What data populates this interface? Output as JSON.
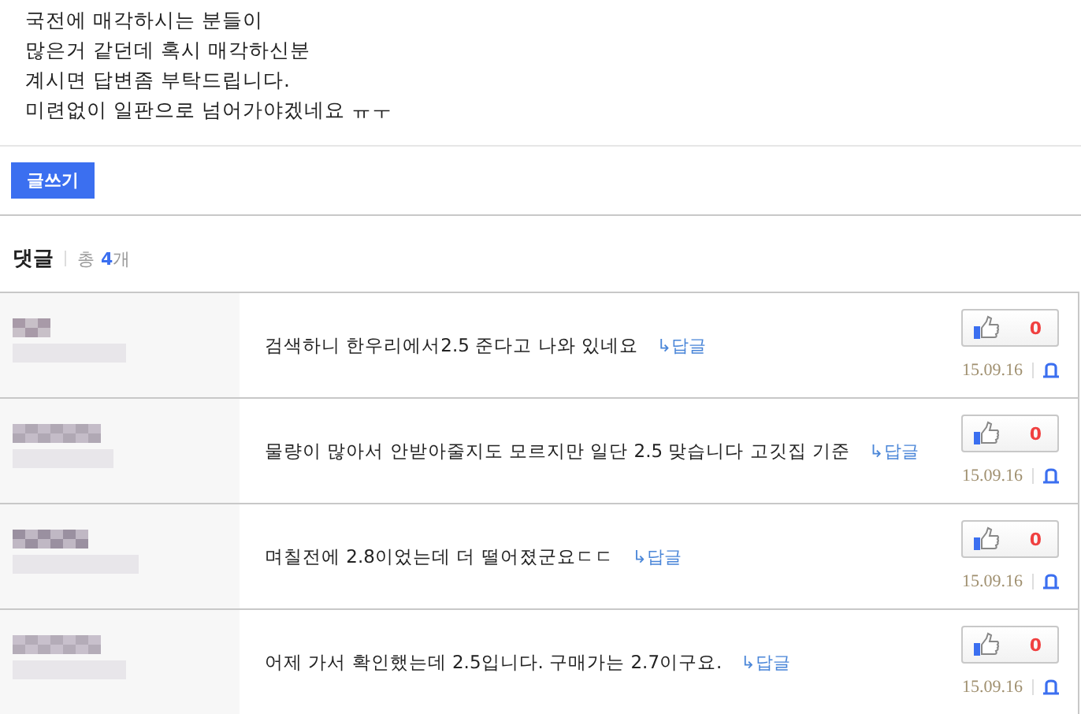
{
  "post": {
    "lines": [
      "국전에 매각하시는 분들이",
      "많은거 같던데 혹시 매각하신분",
      "계시면 답변좀 부탁드립니다.",
      "미련없이 일판으로 넘어가야겠네요 ㅠㅜ"
    ]
  },
  "write_button": "글쓰기",
  "comments_header": {
    "title": "댓글",
    "total_label": "총",
    "count": "4",
    "count_unit": "개"
  },
  "comments": [
    {
      "text": "검색하니 한우리에서2.5 준다고 나와 있네요",
      "reply": "↳답글",
      "likes": "0",
      "date": "15.09.16"
    },
    {
      "text": "물량이 많아서 안받아줄지도 모르지만 일단 2.5 맞습니다 고깃집 기준",
      "reply": "↳답글",
      "likes": "0",
      "date": "15.09.16"
    },
    {
      "text": "며칠전에 2.8이었는데 더 떨어졌군요ㄷㄷ",
      "reply": "↳답글",
      "likes": "0",
      "date": "15.09.16"
    },
    {
      "text": "어제 가서 확인했는데 2.5입니다. 구매가는 2.7이구요.",
      "reply": "↳답글",
      "likes": "0",
      "date": "15.09.16"
    }
  ]
}
